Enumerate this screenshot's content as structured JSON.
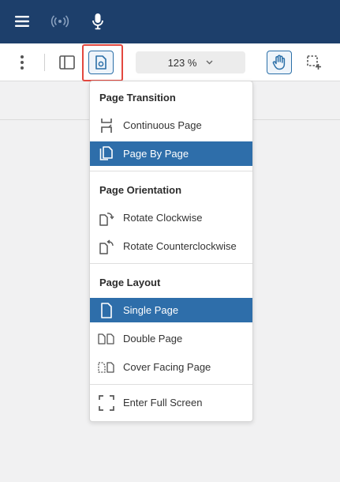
{
  "topbar": {
    "menu_icon": "hamburger-icon",
    "broadcast_icon": "broadcast-icon",
    "mic_icon": "microphone-icon",
    "color": "#1d3f6b"
  },
  "toolbar": {
    "zoom_value": "123 %",
    "active_color": "#2e6eaa",
    "highlight_color": "#e3483f"
  },
  "menu": {
    "transition": {
      "title": "Page Transition",
      "items": [
        "Continuous Page",
        "Page By Page"
      ],
      "selected": "Page By Page"
    },
    "orientation": {
      "title": "Page Orientation",
      "items": [
        "Rotate Clockwise",
        "Rotate Counterclockwise"
      ]
    },
    "layout": {
      "title": "Page Layout",
      "items": [
        "Single Page",
        "Double Page",
        "Cover Facing Page"
      ],
      "selected": "Single Page"
    },
    "fullscreen": "Enter Full Screen"
  }
}
